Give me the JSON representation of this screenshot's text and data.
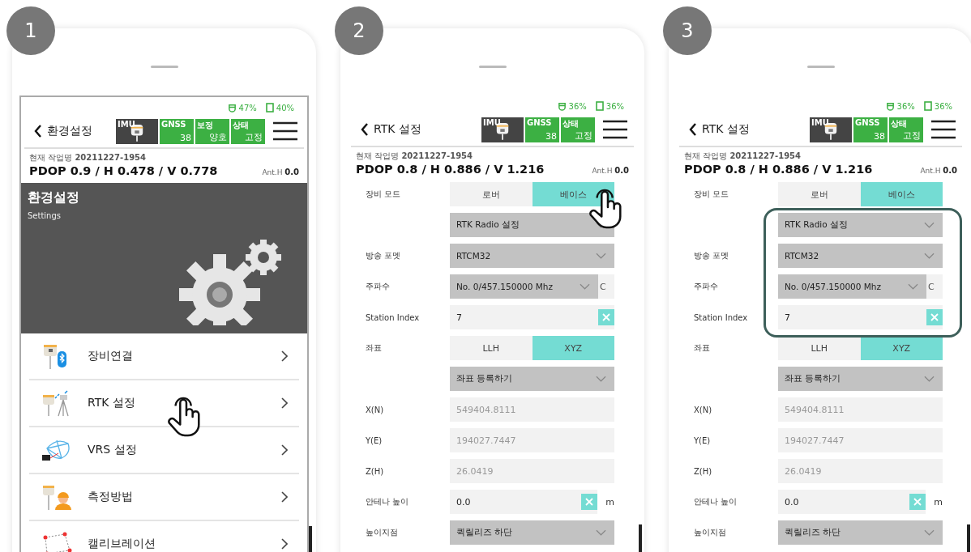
{
  "steps": [
    {
      "number": "1",
      "screen": {
        "kind": "menu",
        "receiver_battery": "47%",
        "phone_battery": "40%",
        "title": "환경설정",
        "tiles": [
          {
            "label": "GNSS",
            "value": "38"
          },
          {
            "label": "보정",
            "value": "양호"
          },
          {
            "label": "상태",
            "value": "고정"
          }
        ],
        "imu_label": "IMU",
        "job_label": "현재 작업명",
        "job_value": "20211227-1954",
        "dop": "PDOP 0.9 / H 0.478 / V 0.778",
        "ant_label": "Ant.H",
        "ant_value": "0.0",
        "banner": {
          "title": "환경설정",
          "subtitle": "Settings"
        },
        "items": [
          {
            "label": "장비연결",
            "tapped": false
          },
          {
            "label": "RTK 설정",
            "tapped": true
          },
          {
            "label": "VRS 설정",
            "tapped": false
          },
          {
            "label": "측정방법",
            "tapped": false
          },
          {
            "label": "캘리브레이션",
            "tapped": false
          }
        ]
      }
    },
    {
      "number": "2",
      "screen": {
        "kind": "form",
        "receiver_battery": "36%",
        "phone_battery": "36%",
        "title": "RTK 설정",
        "tiles": [
          {
            "label": "GNSS",
            "value": "38"
          },
          {
            "label": "상태",
            "value": "고정"
          }
        ],
        "imu_label": "IMU",
        "job_label": "현재 작업명",
        "job_value": "20211227-1954",
        "dop": "PDOP 0.8 / H 0.886 / V 1.216",
        "ant_label": "Ant.H",
        "ant_value": "0.0",
        "rows": [
          {
            "kind": "toggle",
            "label": "장비 모드",
            "highlighted": false,
            "options": [
              {
                "label": "로버",
                "selected": false,
                "tapped": false
              },
              {
                "label": "베이스",
                "selected": true,
                "tapped": true
              }
            ]
          },
          {
            "kind": "dropdown",
            "value": "RTK Radio 설정",
            "highlighted": false
          },
          {
            "kind": "dropdown",
            "label": "방송 포멧",
            "value": "RTCM32",
            "highlighted": false
          },
          {
            "kind": "dropdown",
            "label": "주파수",
            "value": "No. 0/457.150000 Mhz",
            "trailing": "C",
            "highlighted": false
          },
          {
            "kind": "input",
            "label": "Station Index",
            "value": "7",
            "highlighted": false
          },
          {
            "kind": "toggle",
            "label": "좌표",
            "highlighted": false,
            "options": [
              {
                "label": "LLH",
                "selected": false,
                "tapped": false
              },
              {
                "label": "XYZ",
                "selected": true,
                "tapped": false
              }
            ]
          },
          {
            "kind": "dropdown",
            "value": "좌표 등록하기",
            "highlighted": false
          },
          {
            "kind": "readonly",
            "label": "X(N)",
            "value": "549404.8111",
            "highlighted": false
          },
          {
            "kind": "readonly",
            "label": "Y(E)",
            "value": "194027.7447",
            "highlighted": false
          },
          {
            "kind": "readonly",
            "label": "Z(H)",
            "value": "26.0419",
            "highlighted": false
          },
          {
            "kind": "input",
            "label": "안테나 높이",
            "value": "0.0",
            "unit": "m",
            "highlighted": false
          },
          {
            "kind": "dropdown",
            "label": "높이지점",
            "value": "퀵릴리즈 하단",
            "highlighted": false
          }
        ]
      }
    },
    {
      "number": "3",
      "screen": {
        "kind": "form",
        "receiver_battery": "36%",
        "phone_battery": "36%",
        "title": "RTK 설정",
        "tiles": [
          {
            "label": "GNSS",
            "value": "38"
          },
          {
            "label": "상태",
            "value": "고정"
          }
        ],
        "imu_label": "IMU",
        "job_label": "현재 작업명",
        "job_value": "20211227-1954",
        "dop": "PDOP 0.8 / H 0.886 / V 1.216",
        "ant_label": "Ant.H",
        "ant_value": "0.0",
        "rows": [
          {
            "kind": "toggle",
            "label": "장비 모드",
            "highlighted": false,
            "options": [
              {
                "label": "로버",
                "selected": false,
                "tapped": false
              },
              {
                "label": "베이스",
                "selected": true,
                "tapped": false
              }
            ]
          },
          {
            "kind": "dropdown",
            "value": "RTK Radio 설정",
            "highlighted": true
          },
          {
            "kind": "dropdown",
            "label": "방송 포멧",
            "value": "RTCM32",
            "highlighted": true
          },
          {
            "kind": "dropdown",
            "label": "주파수",
            "value": "No. 0/457.150000 Mhz",
            "trailing": "C",
            "highlighted": true
          },
          {
            "kind": "input",
            "label": "Station Index",
            "value": "7",
            "highlighted": true
          },
          {
            "kind": "toggle",
            "label": "좌표",
            "highlighted": false,
            "options": [
              {
                "label": "LLH",
                "selected": false,
                "tapped": false
              },
              {
                "label": "XYZ",
                "selected": true,
                "tapped": false
              }
            ]
          },
          {
            "kind": "dropdown",
            "value": "좌표 등록하기",
            "highlighted": false
          },
          {
            "kind": "readonly",
            "label": "X(N)",
            "value": "549404.8111",
            "highlighted": false
          },
          {
            "kind": "readonly",
            "label": "Y(E)",
            "value": "194027.7447",
            "highlighted": false
          },
          {
            "kind": "readonly",
            "label": "Z(H)",
            "value": "26.0419",
            "highlighted": false
          },
          {
            "kind": "input",
            "label": "안테나 높이",
            "value": "0.0",
            "unit": "m",
            "highlighted": false
          },
          {
            "kind": "dropdown",
            "label": "높이지점",
            "value": "퀵릴리즈 하단",
            "highlighted": false
          }
        ]
      }
    }
  ]
}
